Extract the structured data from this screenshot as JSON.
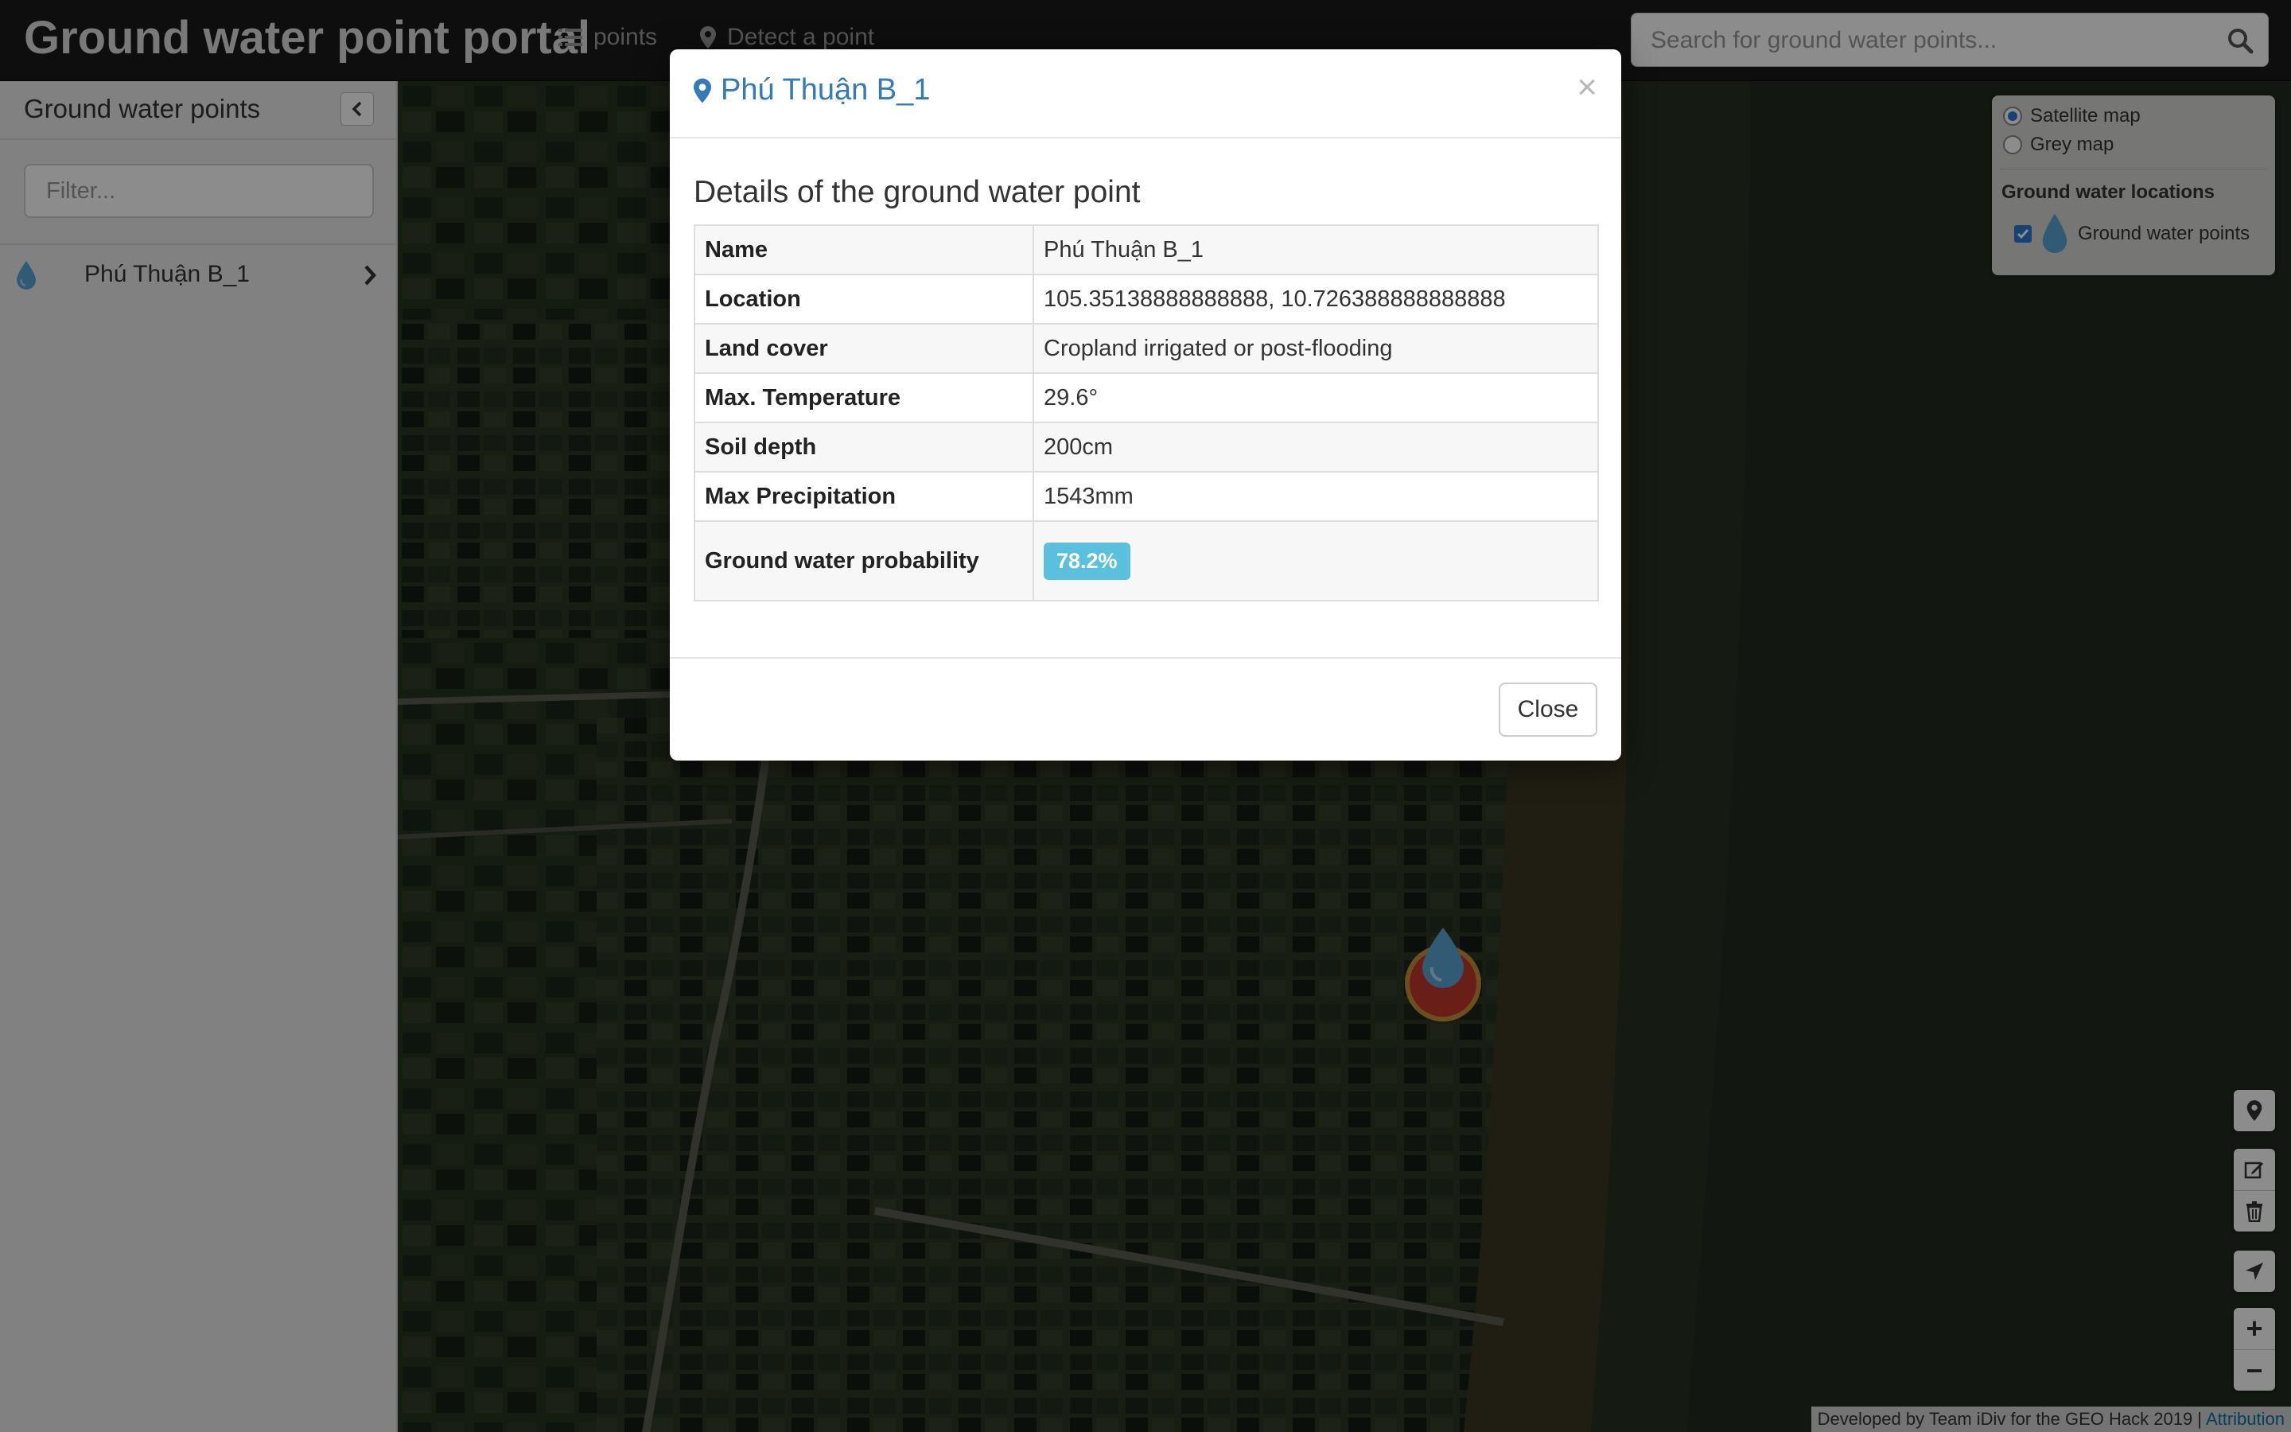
{
  "navbar": {
    "brand": "Ground water point portal",
    "points_label": "points",
    "detect_label": "Detect a point",
    "search_placeholder": "Search for ground water points..."
  },
  "sidebar": {
    "title": "Ground water points",
    "filter_placeholder": "Filter...",
    "items": [
      {
        "name": "Phú Thuận B_1",
        "icon": "water-drop-icon"
      }
    ]
  },
  "map": {
    "base_layers": [
      {
        "label": "Satellite map",
        "selected": true
      },
      {
        "label": "Grey map",
        "selected": false
      }
    ],
    "overlay_heading": "Ground water locations",
    "overlays": [
      {
        "label": "Ground water points",
        "checked": true,
        "icon": "water-drop-icon"
      }
    ],
    "controls": {
      "locate_icon": "map-marker-icon",
      "edit_icon": "edit-icon",
      "delete_icon": "trash-icon",
      "navigate_icon": "location-arrow-icon",
      "zoom_in": "+",
      "zoom_out": "−"
    },
    "attribution_text": "Developed by Team iDiv for the GEO Hack 2019 | ",
    "attribution_link": "Attribution"
  },
  "modal": {
    "title": "Phú Thuận B_1",
    "close_x": "×",
    "subtitle": "Details of the ground water point",
    "details": {
      "name_label": "Name",
      "name_value": "Phú Thuận B_1",
      "location_label": "Location",
      "location_value": "105.35138888888888, 10.726388888888888",
      "landcover_label": "Land cover",
      "landcover_value": "Cropland irrigated or post-flooding",
      "temp_label": "Max. Temperature",
      "temp_value": "29.6°",
      "soil_label": "Soil depth",
      "soil_value": "200cm",
      "precip_label": "Max Precipitation",
      "precip_value": "1543mm",
      "prob_label": "Ground water probability",
      "prob_value": "78.2%"
    },
    "close_button": "Close"
  },
  "colors": {
    "navbar_bg": "#1b1b1b",
    "link_blue": "#337ab7",
    "badge_info": "#5bc0de",
    "marker_red": "#c0392b",
    "drop_blue": "#5aa7d6"
  }
}
